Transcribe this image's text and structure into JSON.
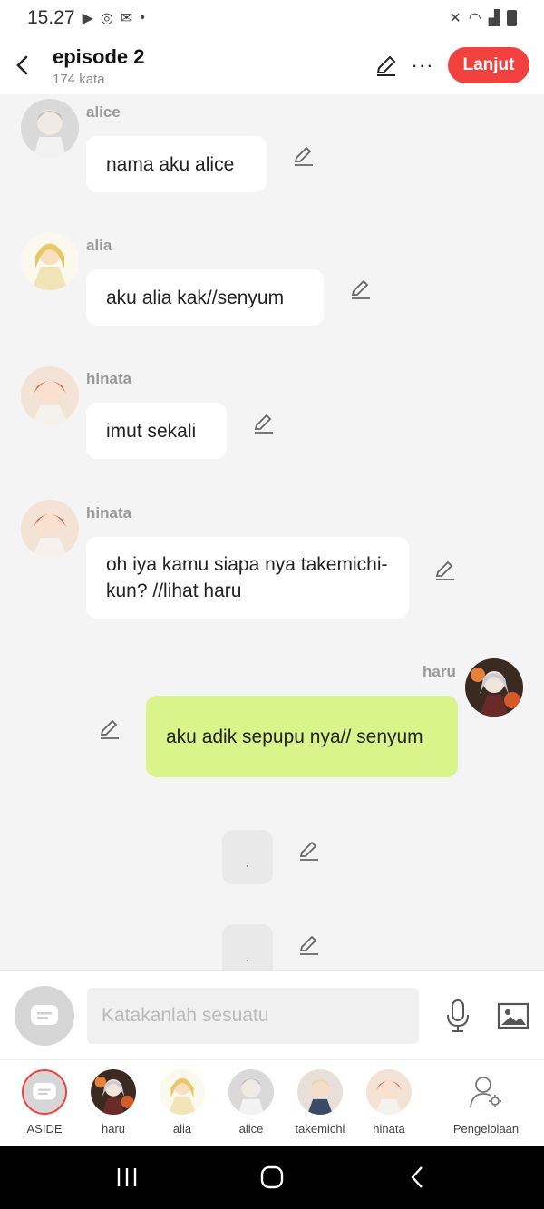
{
  "status": {
    "time": "15.27"
  },
  "header": {
    "title": "episode 2",
    "subtitle": "174 kata",
    "next_label": "Lanjut"
  },
  "messages": [
    {
      "name": "alice",
      "text": "nama aku alice"
    },
    {
      "name": "alia",
      "text": "aku alia kak//senyum"
    },
    {
      "name": "hinata",
      "text": "imut sekali"
    },
    {
      "name": "hinata",
      "text": "oh iya kamu siapa nya takemichi-kun? //lihat haru"
    },
    {
      "name": "haru",
      "text": "aku adik sepupu nya// senyum"
    },
    {
      "text": "."
    },
    {
      "text": "."
    }
  ],
  "input": {
    "placeholder": "Katakanlah sesuatu"
  },
  "tabs": [
    {
      "label": "ASIDE"
    },
    {
      "label": "haru"
    },
    {
      "label": "alia"
    },
    {
      "label": "alice"
    },
    {
      "label": "takemichi"
    },
    {
      "label": "hinata"
    },
    {
      "label": "Pengelolaan"
    }
  ],
  "colors": {
    "accent": "#f0413f",
    "user_bubble": "#d8f48b",
    "bubble": "#ffffff",
    "background": "#f4f4f4"
  }
}
